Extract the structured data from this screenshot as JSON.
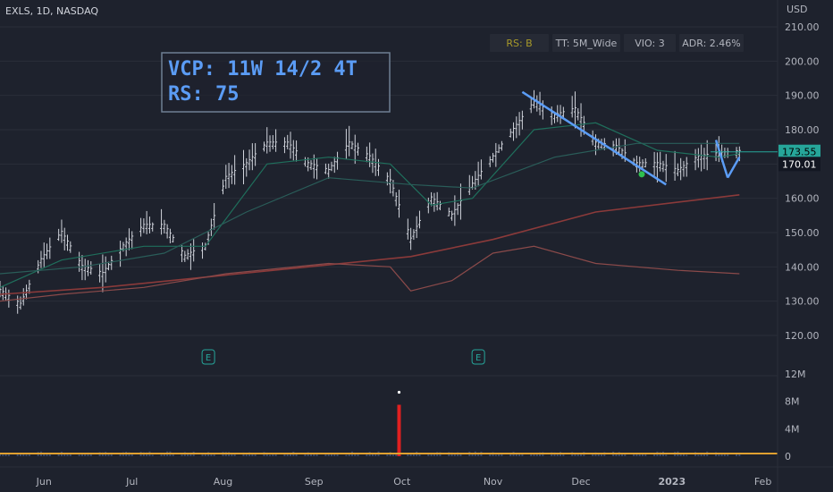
{
  "header": {
    "title": "EXLS, 1D, NASDAQ",
    "currency": "USD"
  },
  "pills": [
    {
      "label": "RS: B",
      "color": "#a89a2a"
    },
    {
      "label": "TT: 5M_Wide",
      "color": "#b2b5be"
    },
    {
      "label": "VIO: 3",
      "color": "#b2b5be"
    },
    {
      "label": "ADR: 2.46%",
      "color": "#b2b5be"
    }
  ],
  "annotation": {
    "line1": "VCP: 11W 14/2 4T",
    "line2": "RS: 75"
  },
  "price_tags": [
    {
      "label": "173.55",
      "value": 173.55,
      "bg": "#26a69a",
      "fg": "#000000"
    },
    {
      "label": "170.01",
      "value": 170.01,
      "bg": "#131722",
      "fg": "#ffffff"
    }
  ],
  "earnings": [
    {
      "label": "E",
      "date": "2022-07-27"
    },
    {
      "label": "E",
      "date": "2022-10-27"
    }
  ],
  "colors": {
    "bars": "#d1d4dc",
    "ma_short": "#1f6f5c",
    "ma_mid": "#2a5d59",
    "ma_long": "#8b3a3a",
    "rs_line": "#8b4a4a",
    "volume_ma": "#e0a030",
    "trendline": "#5b9cf5",
    "vol_spike": "#e02020"
  },
  "chart_data": {
    "type": "line",
    "title": "EXLS, 1D, NASDAQ",
    "xlabel": "",
    "ylabel": "USD",
    "ylim": [
      110,
      212
    ],
    "y_ticks": [
      "210.00",
      "200.00",
      "190.00",
      "180.00",
      "170.00",
      "160.00",
      "150.00",
      "140.00",
      "130.00",
      "120.00"
    ],
    "volume_ticks": [
      "12M",
      "8M",
      "4M",
      "0"
    ],
    "volume_ylim": [
      0,
      12000000
    ],
    "x_tick_labels": [
      "Jun",
      "Jul",
      "Aug",
      "Sep",
      "Oct",
      "Nov",
      "Dec",
      "2023",
      "Feb"
    ],
    "x_tick_dates": [
      "2022-06-01",
      "2022-07-01",
      "2022-08-01",
      "2022-09-01",
      "2022-10-01",
      "2022-11-01",
      "2022-12-01",
      "2023-01-01",
      "2023-02-01"
    ],
    "x_range": [
      "2022-05-17",
      "2023-02-06"
    ],
    "series": [
      {
        "role": "price",
        "points": [
          [
            "2022-05-17",
            133
          ],
          [
            "2022-05-24",
            129
          ],
          [
            "2022-05-31",
            142
          ],
          [
            "2022-06-07",
            150
          ],
          [
            "2022-06-14",
            140
          ],
          [
            "2022-06-21",
            138
          ],
          [
            "2022-06-28",
            146
          ],
          [
            "2022-07-05",
            152
          ],
          [
            "2022-07-12",
            152
          ],
          [
            "2022-07-19",
            143
          ],
          [
            "2022-07-26",
            146
          ],
          [
            "2022-08-02",
            166
          ],
          [
            "2022-08-09",
            170
          ],
          [
            "2022-08-16",
            176
          ],
          [
            "2022-08-23",
            176
          ],
          [
            "2022-08-30",
            170
          ],
          [
            "2022-09-06",
            168
          ],
          [
            "2022-09-13",
            176
          ],
          [
            "2022-09-20",
            172
          ],
          [
            "2022-09-27",
            165
          ],
          [
            "2022-10-04",
            148
          ],
          [
            "2022-10-11",
            160
          ],
          [
            "2022-10-18",
            155
          ],
          [
            "2022-10-25",
            164
          ],
          [
            "2022-11-01",
            172
          ],
          [
            "2022-11-08",
            180
          ],
          [
            "2022-11-15",
            188
          ],
          [
            "2022-11-22",
            184
          ],
          [
            "2022-11-29",
            186
          ],
          [
            "2022-12-06",
            176
          ],
          [
            "2022-12-13",
            175
          ],
          [
            "2022-12-20",
            170
          ],
          [
            "2022-12-27",
            170
          ],
          [
            "2023-01-03",
            168
          ],
          [
            "2023-01-10",
            172
          ],
          [
            "2023-01-17",
            173
          ],
          [
            "2023-01-24",
            173.55
          ]
        ]
      },
      {
        "role": "ma_short",
        "points": [
          [
            "2022-05-17",
            134
          ],
          [
            "2022-06-07",
            142
          ],
          [
            "2022-07-05",
            146
          ],
          [
            "2022-07-26",
            146
          ],
          [
            "2022-08-16",
            170
          ],
          [
            "2022-09-06",
            172
          ],
          [
            "2022-09-27",
            170
          ],
          [
            "2022-10-11",
            158
          ],
          [
            "2022-10-25",
            160
          ],
          [
            "2022-11-15",
            180
          ],
          [
            "2022-12-06",
            182
          ],
          [
            "2022-12-27",
            174
          ],
          [
            "2023-01-17",
            172
          ],
          [
            "2023-01-24",
            173
          ]
        ]
      },
      {
        "role": "ma_mid",
        "points": [
          [
            "2022-05-17",
            138
          ],
          [
            "2022-06-14",
            140
          ],
          [
            "2022-07-12",
            144
          ],
          [
            "2022-08-09",
            156
          ],
          [
            "2022-09-06",
            166
          ],
          [
            "2022-10-04",
            164
          ],
          [
            "2022-10-25",
            163
          ],
          [
            "2022-11-22",
            172
          ],
          [
            "2022-12-20",
            176
          ],
          [
            "2023-01-24",
            176
          ]
        ]
      },
      {
        "role": "ma_long",
        "points": [
          [
            "2022-05-17",
            132
          ],
          [
            "2022-06-21",
            134
          ],
          [
            "2022-07-26",
            137
          ],
          [
            "2022-08-30",
            140
          ],
          [
            "2022-10-04",
            143
          ],
          [
            "2022-11-01",
            148
          ],
          [
            "2022-12-06",
            156
          ],
          [
            "2023-01-24",
            161
          ]
        ]
      },
      {
        "role": "rs_line",
        "points": [
          [
            "2022-05-17",
            130
          ],
          [
            "2022-06-07",
            132
          ],
          [
            "2022-07-05",
            134
          ],
          [
            "2022-08-02",
            138
          ],
          [
            "2022-09-06",
            141
          ],
          [
            "2022-09-27",
            140
          ],
          [
            "2022-10-04",
            133
          ],
          [
            "2022-10-18",
            136
          ],
          [
            "2022-11-01",
            144
          ],
          [
            "2022-11-15",
            146
          ],
          [
            "2022-12-06",
            141
          ],
          [
            "2023-01-03",
            139
          ],
          [
            "2023-01-24",
            138
          ]
        ]
      }
    ],
    "trendlines": [
      [
        [
          "2022-11-11",
          191
        ],
        [
          "2022-12-30",
          164
        ]
      ],
      [
        [
          "2023-01-16",
          177
        ],
        [
          "2023-01-20",
          166
        ]
      ],
      [
        [
          "2023-01-20",
          166
        ],
        [
          "2023-01-24",
          172
        ]
      ]
    ],
    "volume": [
      {
        "date": "2022-09-30",
        "value": 7500000
      }
    ]
  }
}
